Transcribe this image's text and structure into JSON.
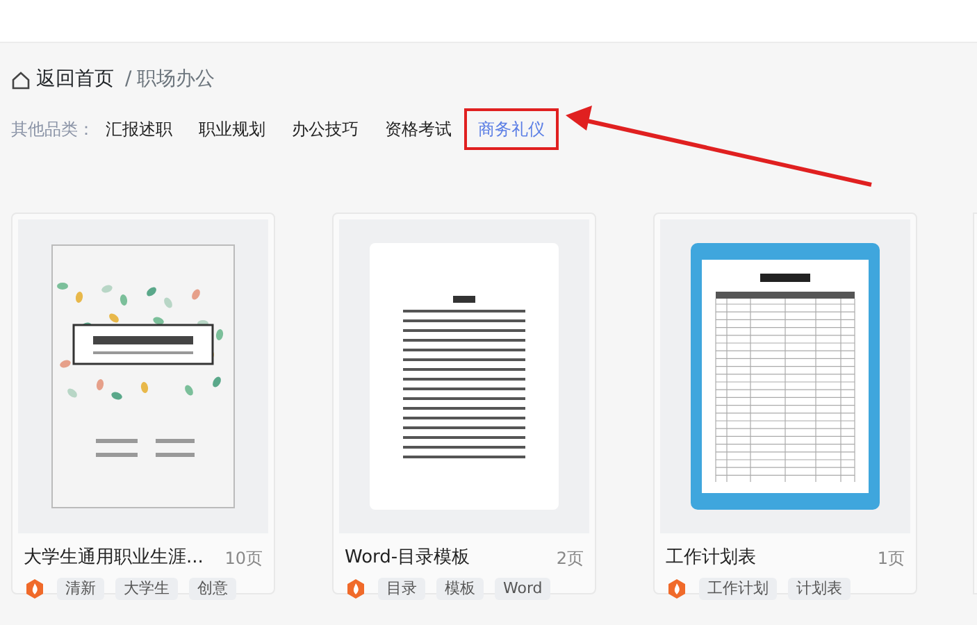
{
  "breadcrumb": {
    "home": "返回首页",
    "separator": "/",
    "current": "职场办公"
  },
  "categories": {
    "label": "其他品类：",
    "items": [
      {
        "label": "汇报述职",
        "selected": false
      },
      {
        "label": "职业规划",
        "selected": false
      },
      {
        "label": "办公技巧",
        "selected": false
      },
      {
        "label": "资格考试",
        "selected": false
      },
      {
        "label": "商务礼仪",
        "selected": true
      }
    ]
  },
  "cards": [
    {
      "kind": "cover",
      "title": "大学生通用职业生涯...",
      "pages": "10页",
      "tags": [
        "清新",
        "大学生",
        "创意"
      ]
    },
    {
      "kind": "toc",
      "title": "Word-目录模板",
      "pages": "2页",
      "tags": [
        "目录",
        "模板",
        "Word"
      ]
    },
    {
      "kind": "table",
      "title": "工作计划表",
      "pages": "1页",
      "tags": [
        "工作计划",
        "计划表"
      ]
    }
  ]
}
